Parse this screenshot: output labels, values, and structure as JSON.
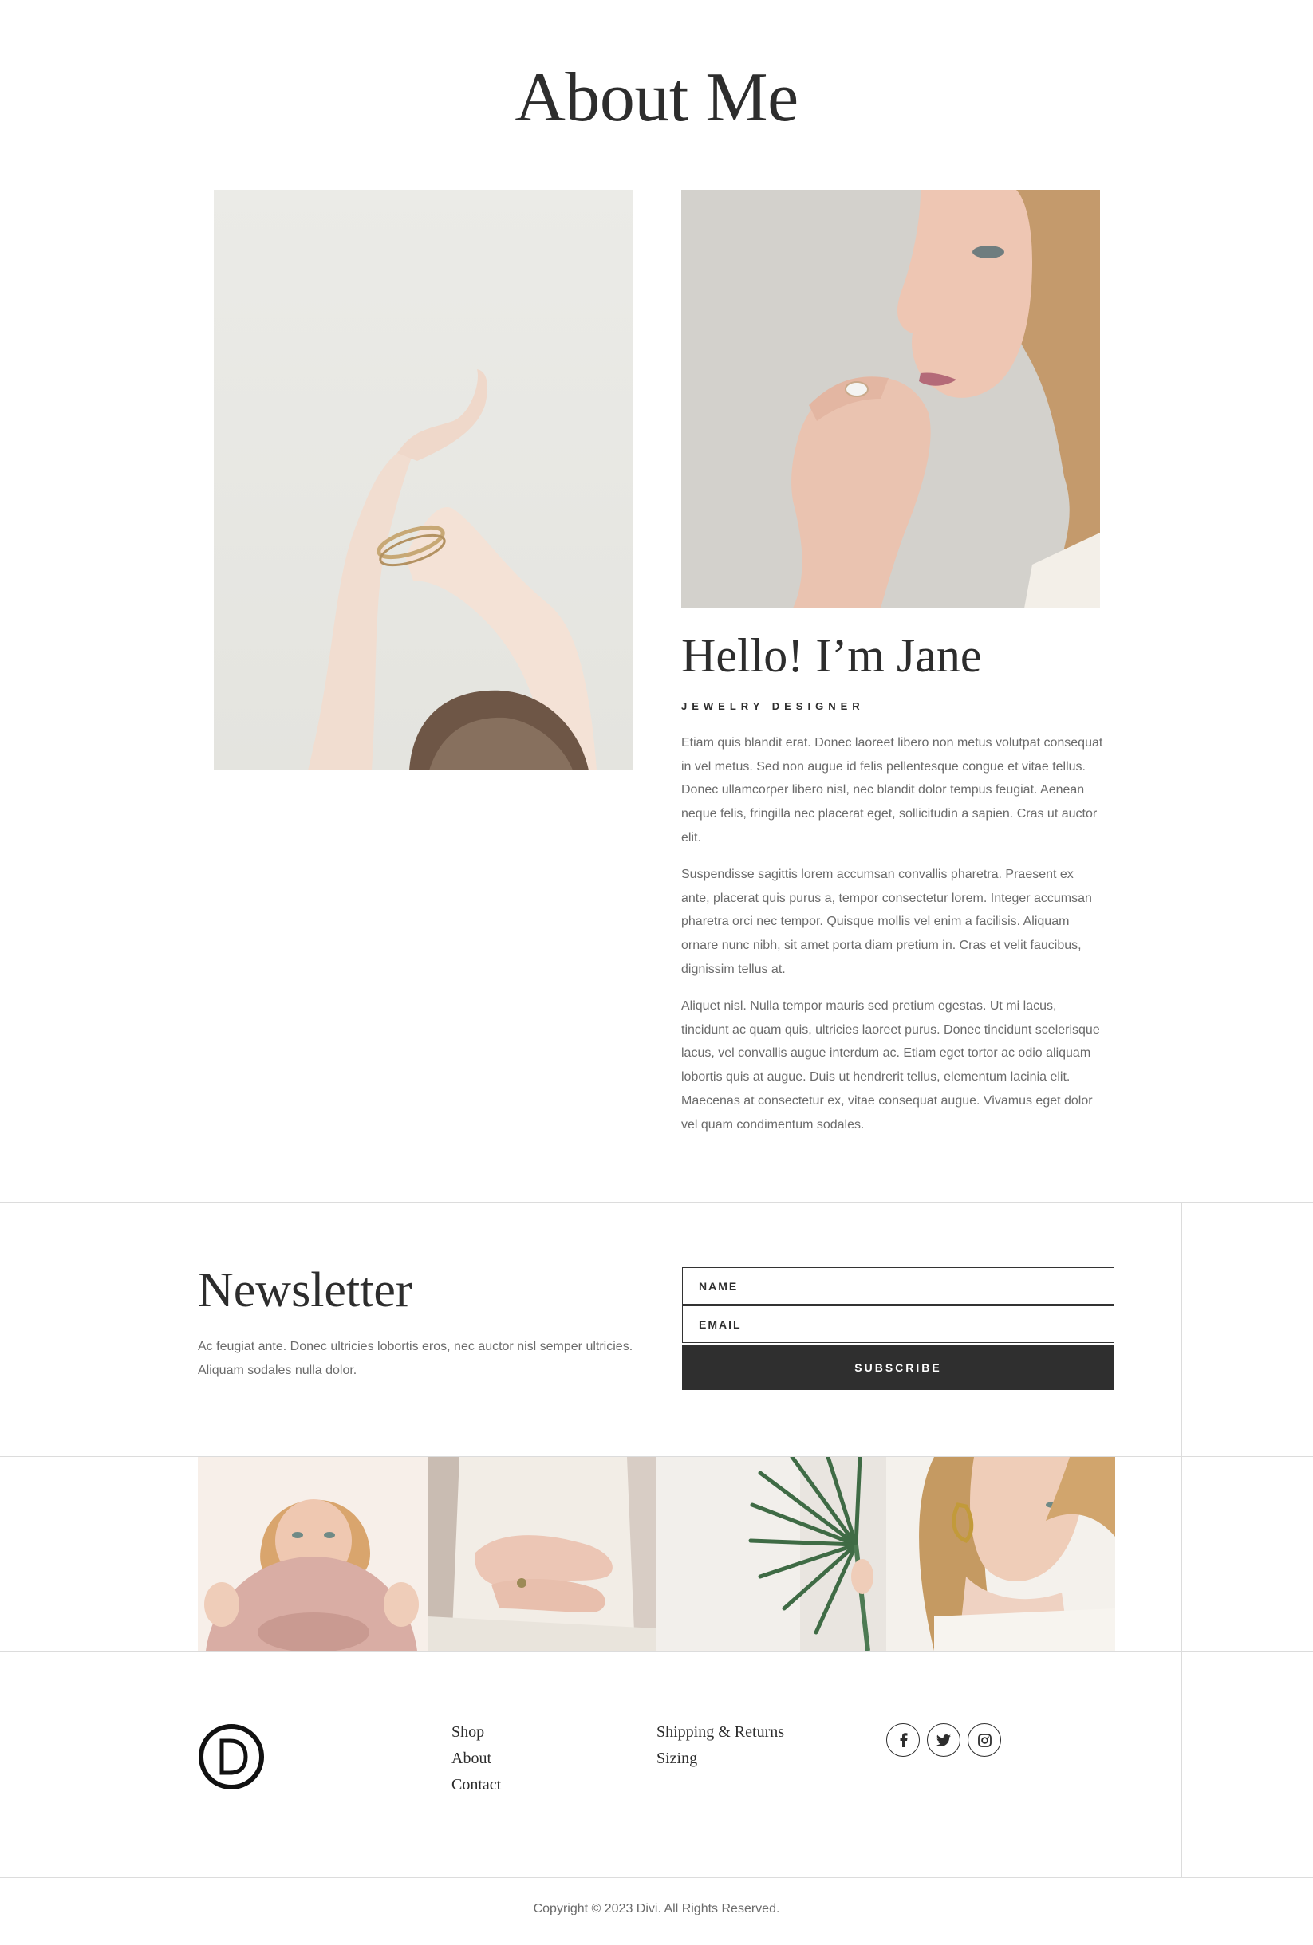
{
  "page": {
    "title": "About Me"
  },
  "bio": {
    "heading": "Hello! I’m Jane",
    "role": "JEWELRY DESIGNER",
    "paragraphs": [
      "Etiam quis blandit erat. Donec laoreet libero non metus volutpat consequat in vel metus. Sed non augue id felis pellentesque congue et vitae tellus. Donec ullamcorper libero nisl, nec blandit dolor tempus feugiat. Aenean neque felis, fringilla nec placerat eget, sollicitudin a sapien. Cras ut auctor elit.",
      "Suspendisse sagittis lorem accumsan convallis pharetra. Praesent ex ante, placerat quis purus a, tempor consectetur lorem. Integer accumsan pharetra orci nec tempor. Quisque mollis vel enim a facilisis. Aliquam ornare nunc nibh, sit amet porta diam pretium in. Cras et velit faucibus, dignissim tellus at.",
      "Aliquet nisl. Nulla tempor mauris sed pretium egestas. Ut mi lacus, tincidunt ac quam quis, ultricies laoreet purus. Donec tincidunt scelerisque lacus, vel convallis augue interdum ac. Etiam eget tortor ac odio aliquam lobortis quis at augue. Duis ut hendrerit tellus, elementum lacinia elit. Maecenas at consectetur ex, vitae consequat augue. Vivamus eget dolor vel quam condimentum sodales."
    ]
  },
  "newsletter": {
    "heading": "Newsletter",
    "text": "Ac feugiat ante. Donec ultricies lobortis eros, nec auctor nisl semper ultricies. Aliquam sodales nulla dolor.",
    "name_placeholder": "NAME",
    "email_placeholder": "EMAIL",
    "subscribe_label": "SUBSCRIBE"
  },
  "footer": {
    "links_col1": [
      "Shop",
      "About",
      "Contact"
    ],
    "links_col2": [
      "Shipping & Returns",
      "Sizing"
    ],
    "social": [
      "facebook-icon",
      "twitter-icon",
      "instagram-icon"
    ],
    "copyright": "Copyright © 2023 Divi. All Rights Reserved."
  },
  "colors": {
    "text_dark": "#2d2d2d",
    "text_body": "#6b6b6b",
    "button_bg": "#2f2f2f",
    "rule": "#dcdcdc"
  }
}
